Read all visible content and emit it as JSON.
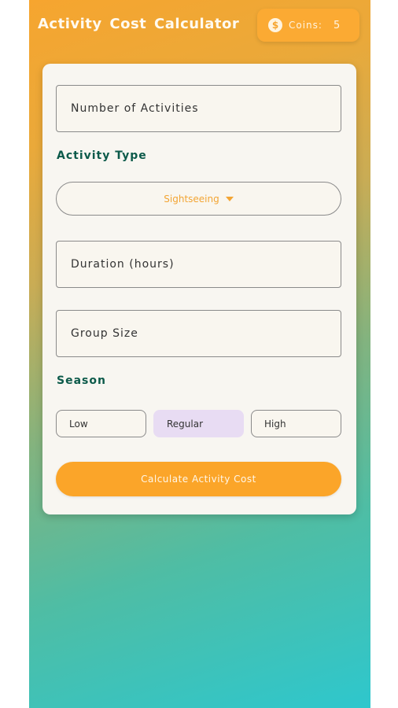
{
  "header": {
    "title": "Activity Cost Calculator",
    "coins_icon": "dollar-coin-icon",
    "coins_label": "Coins:",
    "coins_value": "5"
  },
  "form": {
    "activities_placeholder": "Number of Activities",
    "activity_type_label": "Activity Type",
    "activity_type_value": "Sightseeing",
    "duration_placeholder": "Duration (hours)",
    "group_size_placeholder": "Group Size",
    "season_label": "Season",
    "season_options": [
      "Low",
      "Regular",
      "High"
    ],
    "season_selected": "Regular",
    "calculate_label": "Calculate Activity Cost"
  },
  "colors": {
    "accent": "#fba529",
    "label_green": "#0c5a4a",
    "selected_season": "#e8dcf3"
  }
}
